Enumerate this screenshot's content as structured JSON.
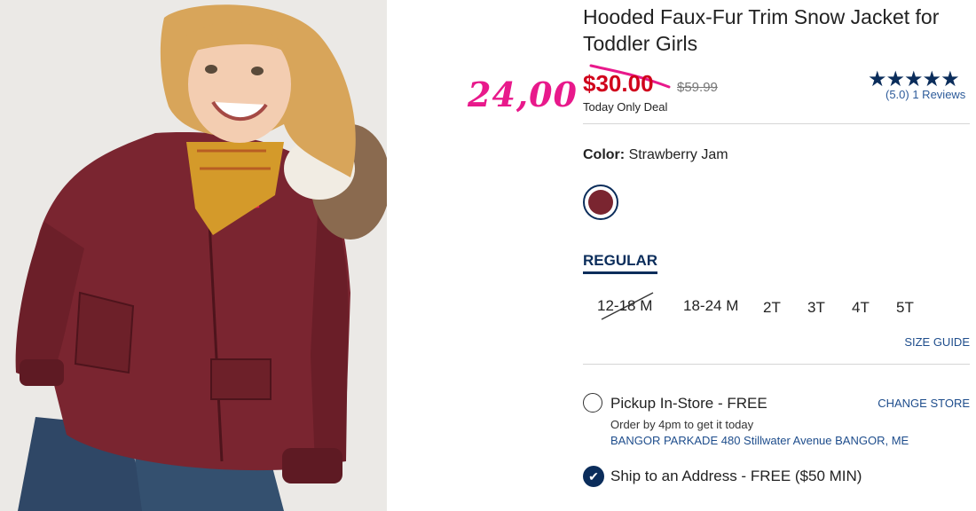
{
  "product": {
    "title": "Hooded Faux-Fur Trim Snow Jacket for Toddler Girls",
    "price_now": "$30.00",
    "price_was": "$59.99",
    "deal_text": "Today Only Deal",
    "overlay_price": "24,00",
    "rating_stars": "★★★★★",
    "reviews_text": "(5.0) 1 Reviews"
  },
  "color": {
    "label": "Color:",
    "value": "Strawberry Jam",
    "swatch_hex": "#7a2530"
  },
  "fit_tab": "REGULAR",
  "sizes": [
    "12-18 M",
    "18-24 M",
    "2T",
    "3T",
    "4T",
    "5T"
  ],
  "size_guide": "SIZE GUIDE",
  "pickup": {
    "label": "Pickup In-Store - FREE",
    "change_store": "CHANGE STORE",
    "order_by": "Order by 4pm to get it today",
    "store_address": "BANGOR PARKADE 480 Stillwater Avenue  BANGOR, ME"
  },
  "ship": {
    "label": "Ship to an Address - FREE ($50 MIN)"
  },
  "colors": {
    "brand_navy": "#0b2d5b",
    "sale_red": "#d0021b",
    "overlay_pink": "#e8198b",
    "link_blue": "#1e4d8c"
  }
}
